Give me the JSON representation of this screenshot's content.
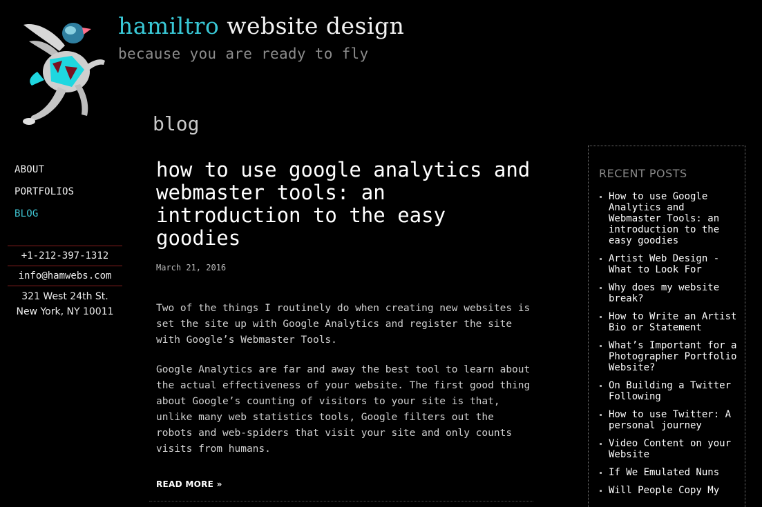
{
  "header": {
    "brand": "hamiltro",
    "title_rest": " website design",
    "tagline": "because you are ready to fly"
  },
  "page": {
    "section_title": "blog"
  },
  "nav": {
    "items": [
      {
        "label": "ABOUT",
        "active": false
      },
      {
        "label": "PORTFOLIOS",
        "active": false
      },
      {
        "label": "BLOG",
        "active": true
      }
    ]
  },
  "contact": {
    "phone": "+1-212-397-1312",
    "email": "info@hamwebs.com",
    "address_line1": "321 West 24th St.",
    "address_line2": "New York, NY 10011"
  },
  "article": {
    "title": "how to use google analytics and webmaster tools: an introduction to the easy goodies",
    "date": "March 21, 2016",
    "paragraphs": [
      "Two of the things I routinely do when creating new websites is set the site up with Google Analytics and register the site with Google’s Webmaster Tools.",
      "Google Analytics are far and away the best tool to learn about the actual effectiveness of your website. The first good thing about Google’s counting of visitors to your site is that, unlike many web statistics tools, Google filters out the robots and web-spiders that visit your site and only counts visits from humans."
    ],
    "read_more": "READ MORE »"
  },
  "sidebar": {
    "heading": "RECENT POSTS",
    "posts": [
      "How to use Google Analytics and Webmaster Tools: an introduction to the easy goodies",
      "Artist Web Design - What to Look For",
      "Why does my website break?",
      "How to Write an Artist Bio or Statement",
      "What’s Important for a Photographer Portfolio Website?",
      "On Building a Twitter Following",
      "How to use Twitter: A personal journey",
      "Video Content on your Website",
      "If We Emulated Nuns",
      "Will People Copy My"
    ]
  },
  "colors": {
    "background": "#000000",
    "accent": "#39c8d6",
    "separator": "#8a1e1e"
  }
}
